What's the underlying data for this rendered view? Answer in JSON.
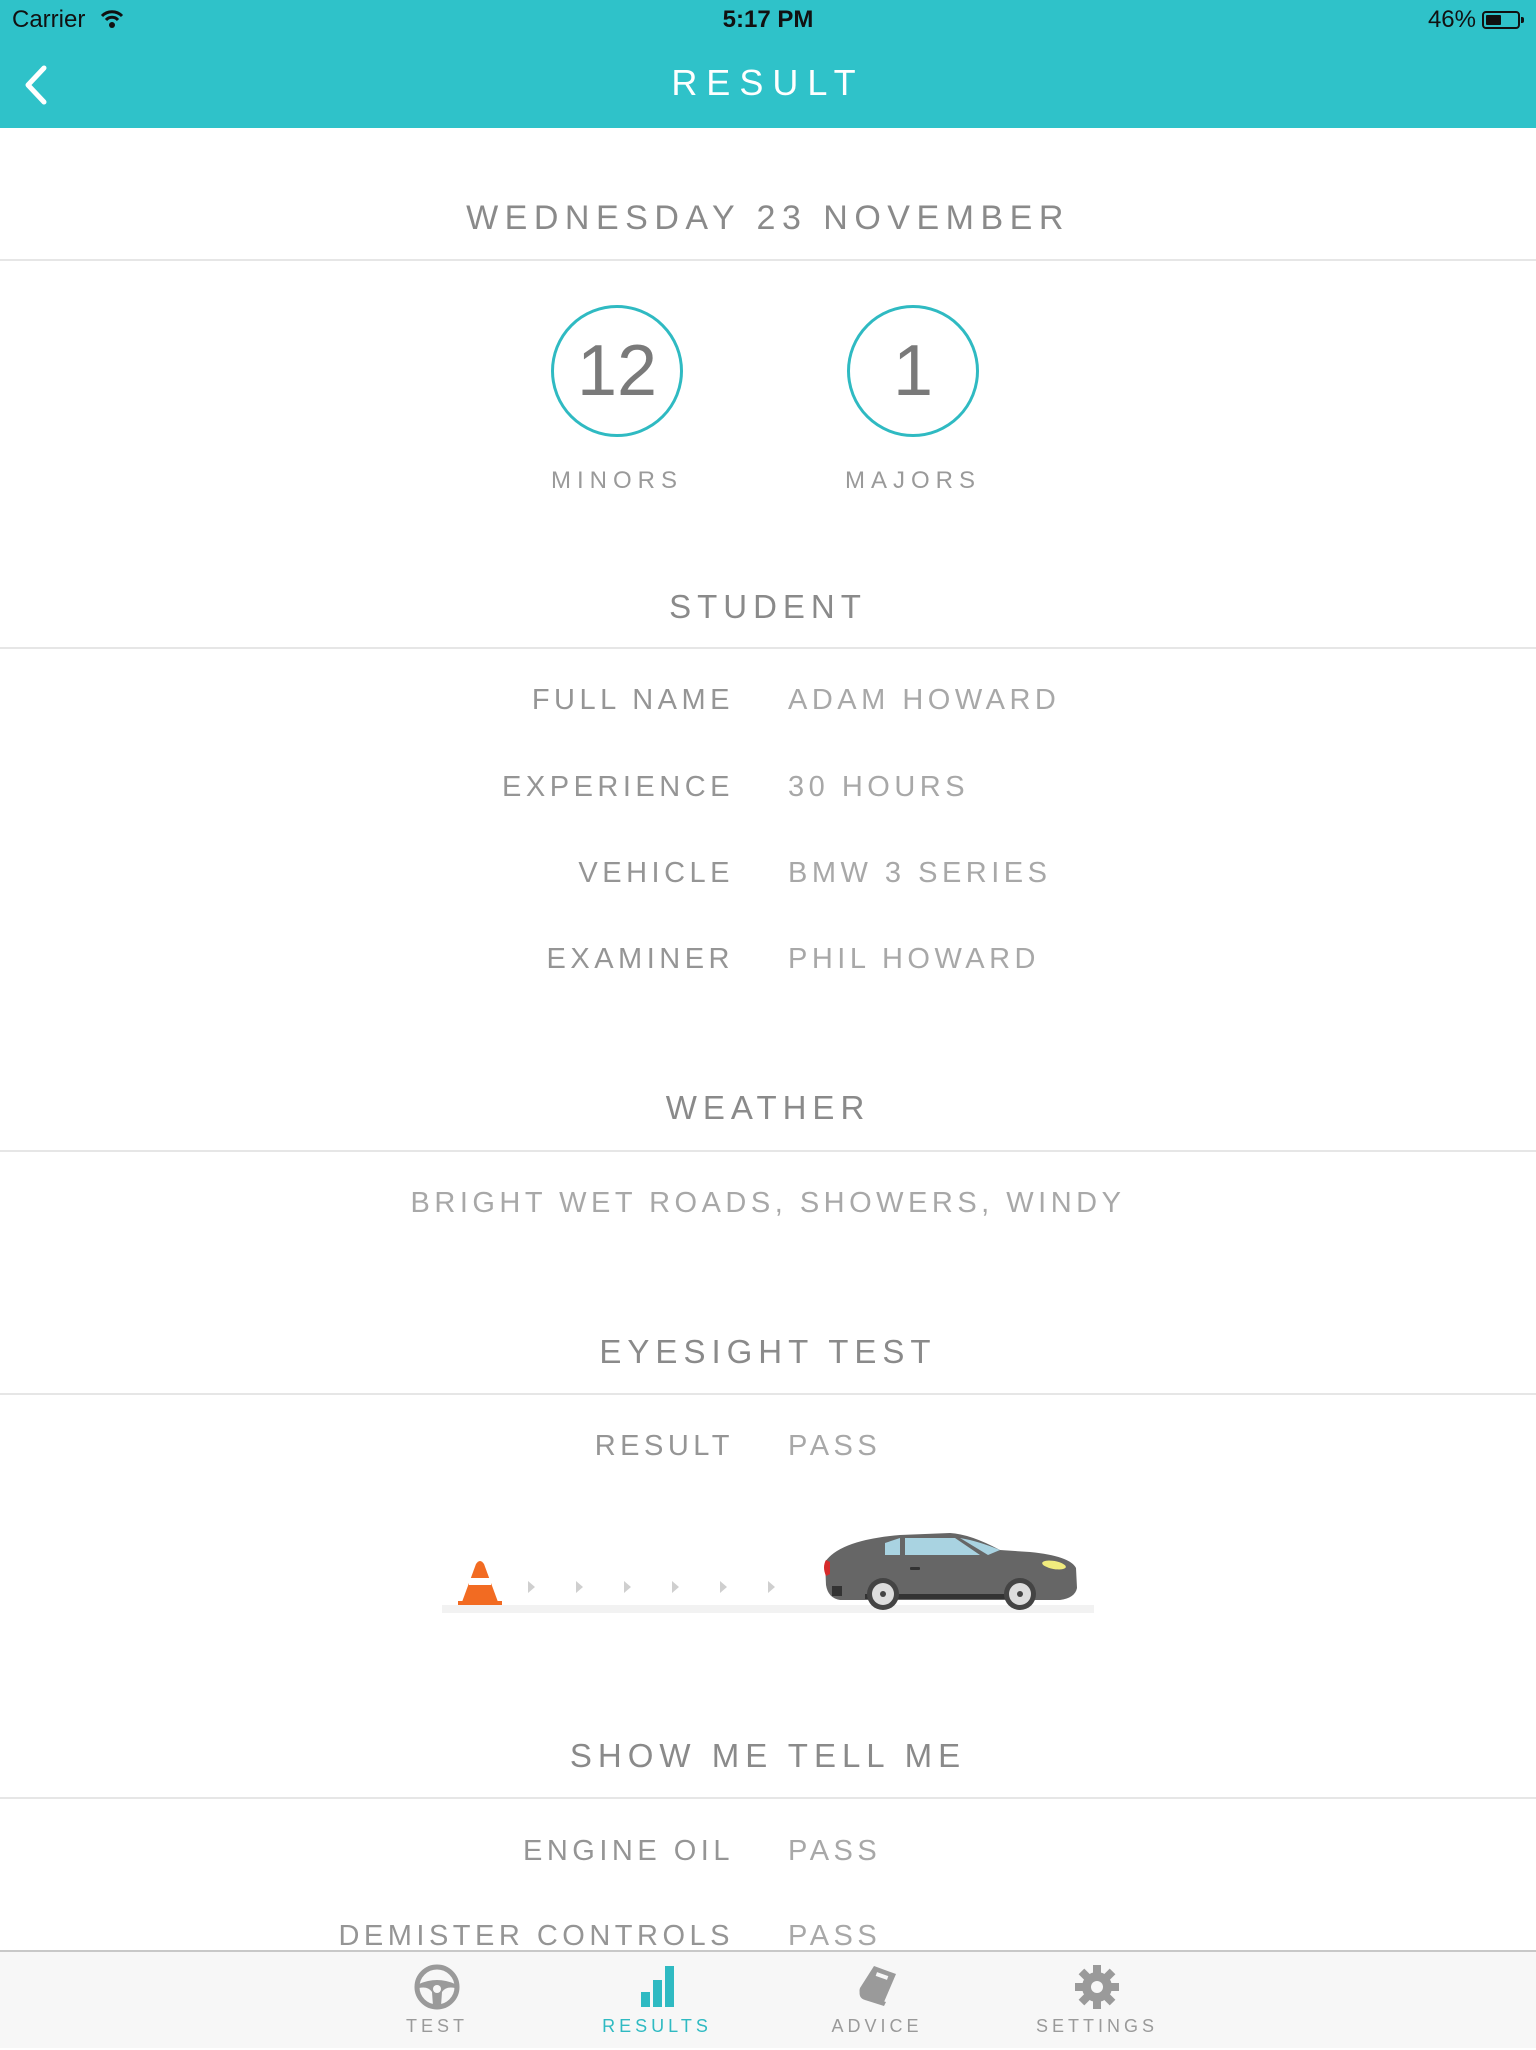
{
  "status_bar": {
    "carrier": "Carrier",
    "time": "5:17 PM",
    "battery": "46%",
    "battery_level": 0.46
  },
  "navbar": {
    "title": "RESULT",
    "back_icon": "chevron-left-icon"
  },
  "date_heading": "WEDNESDAY 23 NOVEMBER",
  "scores": {
    "minors": {
      "value": "12",
      "label": "MINORS"
    },
    "majors": {
      "value": "1",
      "label": "MAJORS"
    }
  },
  "colors": {
    "accent": "#2fc2c9",
    "text_dark": "#8a8a8a",
    "text_light": "#a8a8a8",
    "cone": "#f26b22",
    "car_body": "#666666"
  },
  "student": {
    "title": "STUDENT",
    "rows": [
      {
        "label": "FULL NAME",
        "value": "ADAM HOWARD"
      },
      {
        "label": "EXPERIENCE",
        "value": "30 HOURS"
      },
      {
        "label": "VEHICLE",
        "value": "BMW 3 SERIES"
      },
      {
        "label": "EXAMINER",
        "value": "PHIL HOWARD"
      }
    ]
  },
  "weather": {
    "title": "WEATHER",
    "value": "BRIGHT WET ROADS, SHOWERS, WINDY"
  },
  "eyesight": {
    "title": "EYESIGHT TEST",
    "rows": [
      {
        "label": "RESULT",
        "value": "PASS"
      }
    ],
    "illustration": "car-reversing-to-cone-illustration"
  },
  "show_me_tell_me": {
    "title": "SHOW ME TELL ME",
    "rows": [
      {
        "label": "ENGINE OIL",
        "value": "PASS"
      },
      {
        "label": "DEMISTER CONTROLS",
        "value": "PASS"
      }
    ]
  },
  "tabbar": {
    "tabs": [
      {
        "label": "TEST",
        "icon": "steering-wheel-icon",
        "active": false
      },
      {
        "label": "RESULTS",
        "icon": "bar-chart-icon",
        "active": true
      },
      {
        "label": "ADVICE",
        "icon": "book-icon",
        "active": false
      },
      {
        "label": "SETTINGS",
        "icon": "gear-icon",
        "active": false
      }
    ]
  }
}
